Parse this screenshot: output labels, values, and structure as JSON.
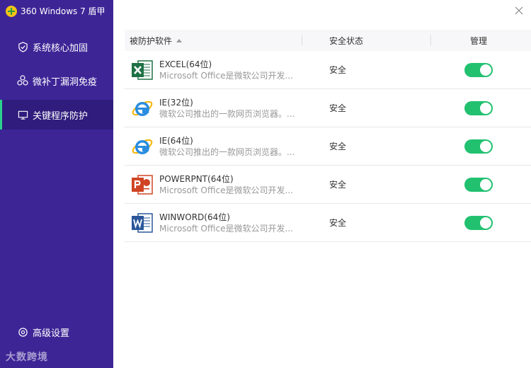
{
  "app": {
    "title": "360 Windows 7 盾甲"
  },
  "sidebar": {
    "items": [
      {
        "label": "系统核心加固",
        "icon": "shield-icon"
      },
      {
        "label": "微补丁漏洞免疫",
        "icon": "molecule-icon"
      },
      {
        "label": "关键程序防护",
        "icon": "monitor-icon"
      }
    ],
    "settings_label": "高级设置",
    "watermark": "大数跨境"
  },
  "table": {
    "headers": {
      "software": "被防护软件",
      "status": "安全状态",
      "manage": "管理"
    },
    "rows": [
      {
        "name": "EXCEL(64位)",
        "desc": "Microsoft Office是微软公司开发...",
        "status": "安全",
        "icon": "excel-icon",
        "enabled": true
      },
      {
        "name": "IE(32位)",
        "desc": "微软公司推出的一款网页浏览器。...",
        "status": "安全",
        "icon": "ie-icon",
        "enabled": true
      },
      {
        "name": "IE(64位)",
        "desc": "微软公司推出的一款网页浏览器。...",
        "status": "安全",
        "icon": "ie-icon",
        "enabled": true
      },
      {
        "name": "POWERPNT(64位)",
        "desc": "Microsoft Office是微软公司开发...",
        "status": "安全",
        "icon": "powerpoint-icon",
        "enabled": true
      },
      {
        "name": "WINWORD(64位)",
        "desc": "Microsoft Office是微软公司开发...",
        "status": "安全",
        "icon": "word-icon",
        "enabled": true
      }
    ]
  },
  "colors": {
    "sidebar_bg": "#3e2596",
    "active_bg": "#2f1c7c",
    "accent": "#2bd18a",
    "toggle_on": "#21c170"
  }
}
